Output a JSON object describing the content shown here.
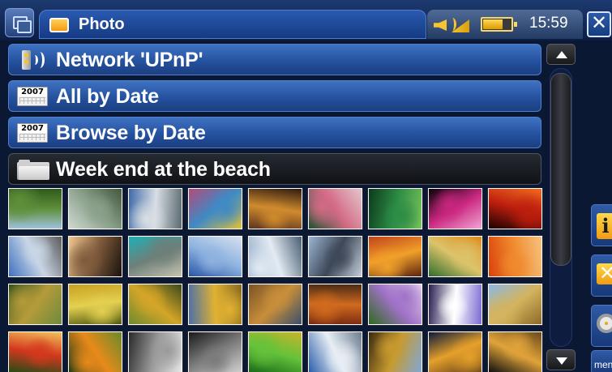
{
  "window": {
    "title": "Photo",
    "icon": "photo-icon"
  },
  "status": {
    "time": "15:59",
    "battery_level": 0.72,
    "volume_icon": "speaker-icon"
  },
  "list": [
    {
      "label": "Network 'UPnP'",
      "icon": "network-upnp-icon"
    },
    {
      "label": "All by Date",
      "icon": "calendar-icon",
      "icon_text": "2007"
    },
    {
      "label": "Browse by Date",
      "icon": "calendar-icon",
      "icon_text": "2007"
    },
    {
      "label": "Week end at the beach",
      "icon": "folder-icon",
      "selected": true
    }
  ],
  "right_rail": {
    "info": "i",
    "delete": "✕",
    "settings": "settings-icon",
    "menu": "menu"
  },
  "thumbnails": [
    {
      "name": "green-hills",
      "colors": [
        "#9fc1dc",
        "#5f8f3a",
        "#2f5a1c"
      ]
    },
    {
      "name": "waterfall-mist",
      "colors": [
        "#cfd9d1",
        "#8aa08a",
        "#42573c"
      ]
    },
    {
      "name": "cloudy-mountains",
      "colors": [
        "#3e6aa8",
        "#d9dfe4",
        "#5a6a70"
      ]
    },
    {
      "name": "colorful-stalls",
      "colors": [
        "#b24b7a",
        "#3f8ac5",
        "#e0c037"
      ]
    },
    {
      "name": "market-shop",
      "colors": [
        "#5d3420",
        "#d08b2d",
        "#2e1b10"
      ]
    },
    {
      "name": "garden-blossoms",
      "colors": [
        "#1f5330",
        "#d46b86",
        "#e4c5cc"
      ]
    },
    {
      "name": "bamboo-forest",
      "colors": [
        "#0c3a1c",
        "#2c8b45",
        "#79c35a"
      ]
    },
    {
      "name": "pink-firework",
      "colors": [
        "#050208",
        "#c9277f",
        "#f2a3d2"
      ]
    },
    {
      "name": "red-firework",
      "colors": [
        "#1b0201",
        "#bb1d0e",
        "#f26b1d"
      ]
    },
    {
      "name": "palace-fountains",
      "colors": [
        "#3f70c0",
        "#c9d6e6",
        "#5a5a5a"
      ]
    },
    {
      "name": "sunset-silhouette",
      "colors": [
        "#f0c78f",
        "#7e5a3c",
        "#1a120c"
      ]
    },
    {
      "name": "turquoise-cave",
      "colors": [
        "#1fb0b8",
        "#6e7f78",
        "#c5c3b0"
      ]
    },
    {
      "name": "skyscrapers-blue",
      "colors": [
        "#2a56a8",
        "#8fb3e0",
        "#d6e0ee"
      ]
    },
    {
      "name": "glass-towers",
      "colors": [
        "#8ba6c4",
        "#e3ebf3",
        "#4a5e74"
      ]
    },
    {
      "name": "ferris-wheel",
      "colors": [
        "#9ab4d2",
        "#3d4757",
        "#c3ccd8"
      ]
    },
    {
      "name": "spice-jars",
      "colors": [
        "#c1441a",
        "#f1a02a",
        "#5a2410"
      ]
    },
    {
      "name": "tea-set-cups",
      "colors": [
        "#2f6d2e",
        "#dcc36a",
        "#e08a1a"
      ]
    },
    {
      "name": "orange-pasta",
      "colors": [
        "#d9420b",
        "#f08a2e",
        "#f6c27e"
      ]
    },
    {
      "name": "autumn-park",
      "colors": [
        "#2d4f1a",
        "#b59b3a",
        "#6e8a3c"
      ]
    },
    {
      "name": "yellow-foliage",
      "colors": [
        "#c8a020",
        "#e4d050",
        "#4f5a12"
      ]
    },
    {
      "name": "autumn-branches",
      "colors": [
        "#6e8c2e",
        "#d4a527",
        "#3b4a1a"
      ]
    },
    {
      "name": "golden-trees-lake",
      "colors": [
        "#4d6fa8",
        "#e0b232",
        "#8a6a20"
      ]
    },
    {
      "name": "tree-by-water",
      "colors": [
        "#7a5325",
        "#c88e3a",
        "#3a4f6a"
      ]
    },
    {
      "name": "red-autumn-forest",
      "colors": [
        "#7a2a12",
        "#d06a1e",
        "#4a2a14"
      ]
    },
    {
      "name": "purple-alliums",
      "colors": [
        "#2f6a1e",
        "#a072c8",
        "#e6d2ee"
      ]
    },
    {
      "name": "iris-flower",
      "colors": [
        "#2a1e52",
        "#ffffff",
        "#7a6ad2"
      ]
    },
    {
      "name": "hay-bales",
      "colors": [
        "#8bb8e6",
        "#d4b45e",
        "#8c6a28"
      ]
    },
    {
      "name": "red-apple",
      "colors": [
        "#2a4a16",
        "#d4381e",
        "#f2c25a"
      ]
    },
    {
      "name": "orange-fruits-tree",
      "colors": [
        "#1f3a14",
        "#e88a1a",
        "#6a8a2a"
      ]
    },
    {
      "name": "city-bw",
      "colors": [
        "#2a2a2a",
        "#9a9a9a",
        "#e6e6e6"
      ]
    },
    {
      "name": "gargoyle-bw",
      "colors": [
        "#1a1a1a",
        "#7a7a7a",
        "#cfcfcf"
      ]
    },
    {
      "name": "green-parrot",
      "colors": [
        "#1a6b1a",
        "#65c23a",
        "#c8b42a"
      ]
    },
    {
      "name": "snowy-lake",
      "colors": [
        "#2b5fa8",
        "#e8eef4",
        "#6b7d90"
      ]
    },
    {
      "name": "golden-statue",
      "colors": [
        "#3a2a10",
        "#c79a2e",
        "#7fa8d6"
      ]
    },
    {
      "name": "night-bridge",
      "colors": [
        "#0c1a3c",
        "#e6a02a",
        "#5a3a1a"
      ]
    },
    {
      "name": "lit-building-night",
      "colors": [
        "#101010",
        "#e0a33a",
        "#6a4a1a"
      ]
    }
  ]
}
